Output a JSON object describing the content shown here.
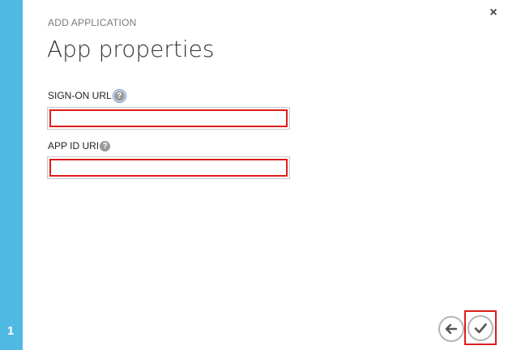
{
  "wizard": {
    "step_number": "1",
    "subtitle": "ADD APPLICATION",
    "title": "App properties",
    "close_symbol": "×"
  },
  "fields": [
    {
      "label": "SIGN-ON URL",
      "help": "?",
      "value": "",
      "placeholder": ""
    },
    {
      "label": "APP ID URI",
      "help": "?",
      "value": "",
      "placeholder": ""
    }
  ],
  "icons": {
    "close": "close-icon",
    "help": "question-mark-icon",
    "back": "arrow-left-icon",
    "confirm": "checkmark-icon"
  },
  "colors": {
    "rail": "#4fb8e3",
    "highlight": "#e01c1c",
    "help_icon": "#9a9a9a"
  }
}
